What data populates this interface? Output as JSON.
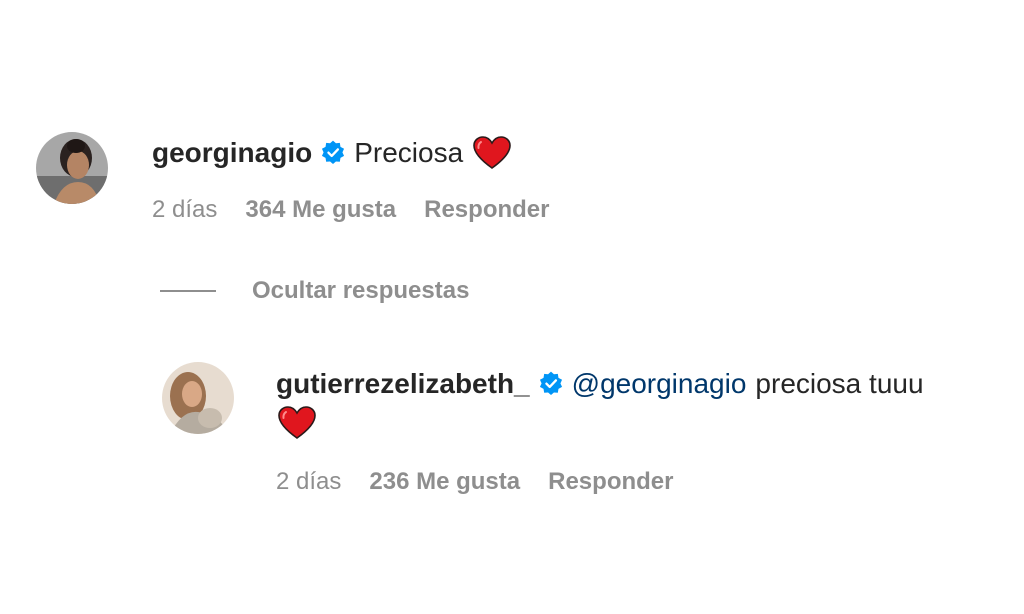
{
  "comments": [
    {
      "username": "georginagio",
      "verified": true,
      "text": "Preciosa",
      "emoji": "red-heart-icon",
      "time": "2 días",
      "likes": "364 Me gusta",
      "reply_label": "Responder"
    }
  ],
  "replies_toggle": {
    "label": "Ocultar respuestas"
  },
  "replies": [
    {
      "username": "gutierrezelizabeth_",
      "verified": true,
      "mention": "@georginagio",
      "text": "preciosa tuuu",
      "emoji": "red-heart-icon",
      "time": "2 días",
      "likes": "236 Me gusta",
      "reply_label": "Responder"
    }
  ],
  "colors": {
    "username": "#262626",
    "meta": "#8e8e8e",
    "mention": "#00376b",
    "verified_badge": "#0095f6",
    "heart": "#e0161e"
  }
}
